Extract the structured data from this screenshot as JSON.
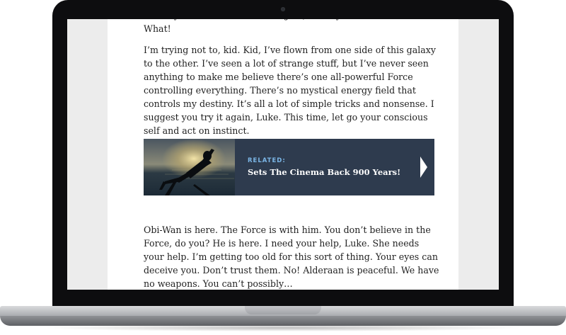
{
  "article": {
    "top_partial": "the ways of the Force and be a Jedi, like my father before me. What!",
    "paragraph1": "I’m trying not to, kid. Kid, I’ve flown from one side of this galaxy to the other. I’ve seen a lot of strange stuff, but I’ve never seen anything to make me believe there’s one all-powerful Force controlling everything. There’s no mystical energy field that controls my destiny. It’s all a lot of simple tricks and nonsense. I suggest you try it again, Luke. This time, let go your conscious self and act on instinct.",
    "related": {
      "label": "RELATED:",
      "title": "Sets The Cinema Back 900 Years!",
      "color": "#2e3b4e",
      "label_color": "#7bb6e6",
      "icon": "chevron-right-icon"
    },
    "paragraph2": "Obi-Wan is here. The Force is with him. You don’t believe in the Force, do you? He is here. I need your help, Luke. She needs your help. I’m getting too old for this sort of thing. Your eyes can deceive you. Don’t trust them. No! Alderaan is peaceful. We have no weapons. You can’t possibly…"
  }
}
